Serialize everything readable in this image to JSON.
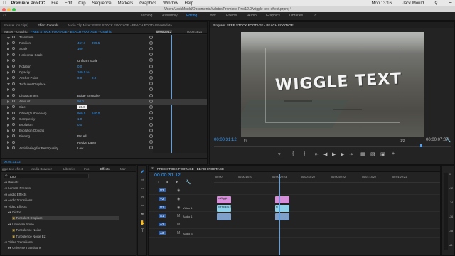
{
  "mac_menu": {
    "apple_icon": "apple-icon",
    "app_name": "Premiere Pro CC",
    "items": [
      "File",
      "Edit",
      "Clip",
      "Sequence",
      "Markers",
      "Graphics",
      "Window",
      "Help"
    ],
    "clock": "Mon 13:16",
    "user": "Jack Mould"
  },
  "window": {
    "title": "/Users/JackMould/Documents/Adobe/Premiere Pro/12.0/wiggle text effect.prproj *"
  },
  "workspaces": {
    "tabs": [
      "Learning",
      "Assembly",
      "Editing",
      "Color",
      "Effects",
      "Audio",
      "Graphics",
      "Libraries"
    ],
    "active": "Editing"
  },
  "effect_controls": {
    "tabs": [
      "Source: (no clips)",
      "Effect Controls",
      "Audio Clip Mixer: FREE STOCK FOOTAGE - BEACH FOOTAGE",
      "Metadata"
    ],
    "master": "Master * Graphic",
    "clip": "FREE STOCK FOOTAGE - BEACH FOOTAGE * Graphic",
    "ruler_start": "00:00:29:12",
    "ruler_end": "00:00:34:21",
    "rows": [
      {
        "label": "Transform",
        "value": "",
        "value2": ""
      },
      {
        "label": "Position",
        "value": "467.7",
        "value2": "379.5"
      },
      {
        "label": "Scale",
        "value": "100",
        "value2": ""
      },
      {
        "label": "Horizontal Scale",
        "value": "",
        "value2": ""
      },
      {
        "label": "",
        "value": "Uniform Scale",
        "value2": ""
      },
      {
        "label": "Rotation",
        "value": "0.0",
        "value2": ""
      },
      {
        "label": "Opacity",
        "value": "100.0 %",
        "value2": ""
      },
      {
        "label": "Anchor Point",
        "value": "0.0",
        "value2": "0.0"
      },
      {
        "label": "Turbulent Displace",
        "value": "",
        "value2": ""
      },
      {
        "label": "",
        "value": "",
        "value2": ""
      },
      {
        "label": "Displacement",
        "value": "Bulge Smoother",
        "value2": ""
      },
      {
        "label": "Amount",
        "value": "50.0",
        "value2": ""
      },
      {
        "label": "Size",
        "value": "20.0",
        "value2": ""
      },
      {
        "label": "Offset (Turbulence)",
        "value": "960.0",
        "value2": "540.0"
      },
      {
        "label": "Complexity",
        "value": "1.0",
        "value2": ""
      },
      {
        "label": "Evolution",
        "value": "0.0",
        "value2": ""
      },
      {
        "label": "Evolution Options",
        "value": "",
        "value2": ""
      },
      {
        "label": "Pinning",
        "value": "Pin All",
        "value2": ""
      },
      {
        "label": "",
        "value": "Resize Layer",
        "value2": ""
      },
      {
        "label": "Antialiasing for Best Quality",
        "value": "Low",
        "value2": ""
      }
    ],
    "timecode": "00:00:31:12"
  },
  "program": {
    "title": "Program: FREE STOCK FOOTAGE - BEACH FOOTAGE",
    "overlay_text": "WIGGLE TEXT",
    "timecode": "00:00:31:12",
    "fit": "Fit",
    "quality": "1/2",
    "duration": "00:00:07:07"
  },
  "effects_panel": {
    "tabs": [
      "ggle text effect",
      "Media Browser",
      "Libraries",
      "Info",
      "Effects",
      "Mar"
    ],
    "search_value": "turb",
    "items": [
      {
        "label": "Presets",
        "level": 0
      },
      {
        "label": "Lumetri Presets",
        "level": 0
      },
      {
        "label": "Audio Effects",
        "level": 0
      },
      {
        "label": "Audio Transitions",
        "level": 0
      },
      {
        "label": "Video Effects",
        "level": 0
      },
      {
        "label": "Distort",
        "level": 1
      },
      {
        "label": "Turbulent Displace",
        "level": 2
      },
      {
        "label": "Universe Noise",
        "level": 1
      },
      {
        "label": "Turbulence Noise",
        "level": 2
      },
      {
        "label": "Turbulence Noise EZ",
        "level": 2
      },
      {
        "label": "Video Transitions",
        "level": 0
      },
      {
        "label": "Universe Transitions",
        "level": 1
      }
    ]
  },
  "timeline": {
    "tab": "FREE STOCK FOOTAGE - BEACH FOOTAGE",
    "timecode": "00:00:31:12",
    "ruler": [
      "00:00",
      "00:00:14:23",
      "00:00:29:23",
      "00:00:44:22",
      "00:00:59:22",
      "00:01:14:22",
      "00:01:29:21"
    ],
    "tracks": [
      {
        "name": "V3",
        "label": "",
        "clips": []
      },
      {
        "name": "V2",
        "label": "",
        "clips": [
          {
            "text": "fx Wiggle",
            "color": "#d58fd8"
          },
          {
            "text": "",
            "color": "#d58fd8"
          }
        ]
      },
      {
        "name": "V1",
        "label": "Video 1",
        "clips": [
          {
            "text": "fx FREE STOCK FOOTAGE",
            "color": "#8fd1e8"
          },
          {
            "text": "fx",
            "color": "#8fd1e8"
          }
        ]
      },
      {
        "name": "A1",
        "label": "Audio 1",
        "clips": []
      },
      {
        "name": "A2",
        "label": "",
        "clips": []
      },
      {
        "name": "A3",
        "label": "Audio 3",
        "clips": []
      }
    ],
    "meter_labels": [
      "0",
      "-12",
      "-24",
      "-36",
      "-48",
      "dB"
    ]
  },
  "colors": {
    "accent": "#2f9bff",
    "video_clip": "#8fd1e8",
    "graphic_clip": "#d58fd8",
    "audio_clip": "#7fa0c8",
    "playhead": "#4aa3ff"
  }
}
